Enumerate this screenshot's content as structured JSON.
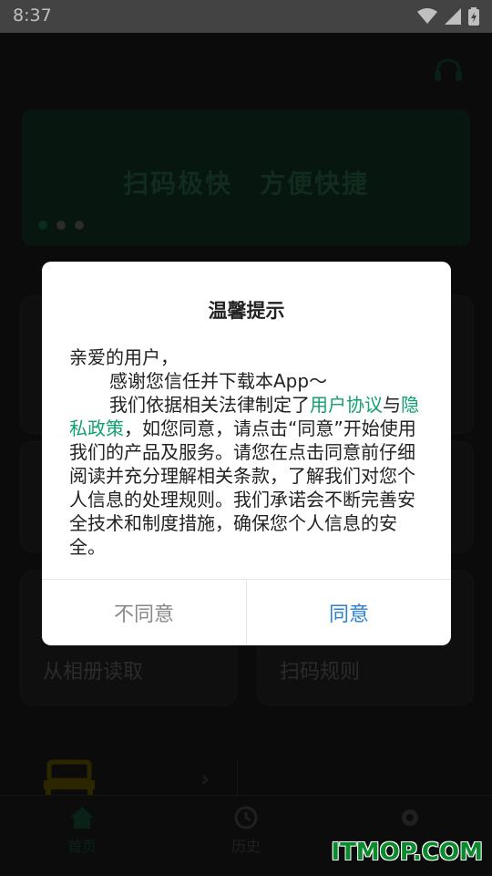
{
  "status_bar": {
    "time": "8:37"
  },
  "banner": {
    "text": "扫码极快　方便快捷",
    "dots": 3
  },
  "cards": {
    "album_label": "从相册读取",
    "rules_label": "扫码规则"
  },
  "bottom_nav": {
    "home": "首页",
    "history": "历史"
  },
  "dialog": {
    "title": "温馨提示",
    "greeting": "亲爱的用户，",
    "line1": "感谢您信任并下载本App～",
    "line2_prefix": "我们依据相关法律制定了",
    "user_agreement": "用户协议",
    "and": "与",
    "privacy_policy": "隐私政策",
    "line2_suffix": "，如您同意，请点击“同意”开始使用我们的产品及服务。请您在点击同意前仔细阅读并充分理解相关条款，了解我们对您个人信息的处理规则。我们承诺会不断完善安全技术和制度措施，确保您个人信息的安全。",
    "disagree": "不同意",
    "agree": "同意"
  },
  "watermark": "ITMOP.COM",
  "colors": {
    "link": "#12a06e",
    "agree": "#2c7fd5",
    "watermark": "#0b8a2d"
  }
}
